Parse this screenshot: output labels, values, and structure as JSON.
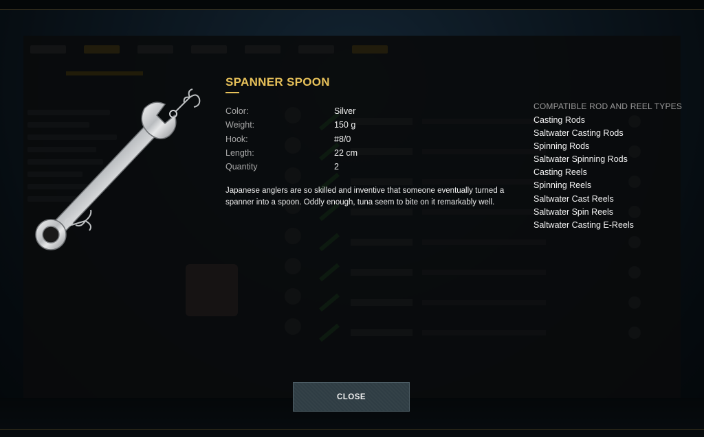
{
  "item": {
    "title": "SPANNER SPOON",
    "image_icon": "spanner-spoon-lure-icon",
    "properties": [
      {
        "label": "Color:",
        "value": "Silver"
      },
      {
        "label": "Weight:",
        "value": "150 g"
      },
      {
        "label": "Hook:",
        "value": "#8/0"
      },
      {
        "label": "Length:",
        "value": "22 cm"
      },
      {
        "label": "Quantity",
        "value": "2"
      }
    ],
    "description": "Japanese anglers are so skilled and inventive that someone eventually turned a spanner into a spoon. Oddly enough, tuna seem to bite on it remarkably well."
  },
  "compatible": {
    "title": "COMPATIBLE ROD AND REEL TYPES",
    "items": [
      "Casting Rods",
      "Saltwater Casting Rods",
      "Spinning Rods",
      "Saltwater Spinning Rods",
      "Casting Reels",
      "Spinning Reels",
      "Saltwater Cast Reels",
      "Saltwater Spin Reels",
      "Saltwater Casting E-Reels"
    ]
  },
  "actions": {
    "close_label": "CLOSE"
  },
  "colors": {
    "accent": "#e8c25a",
    "button_bg": "#2f3d44",
    "overlay": "#000000"
  }
}
